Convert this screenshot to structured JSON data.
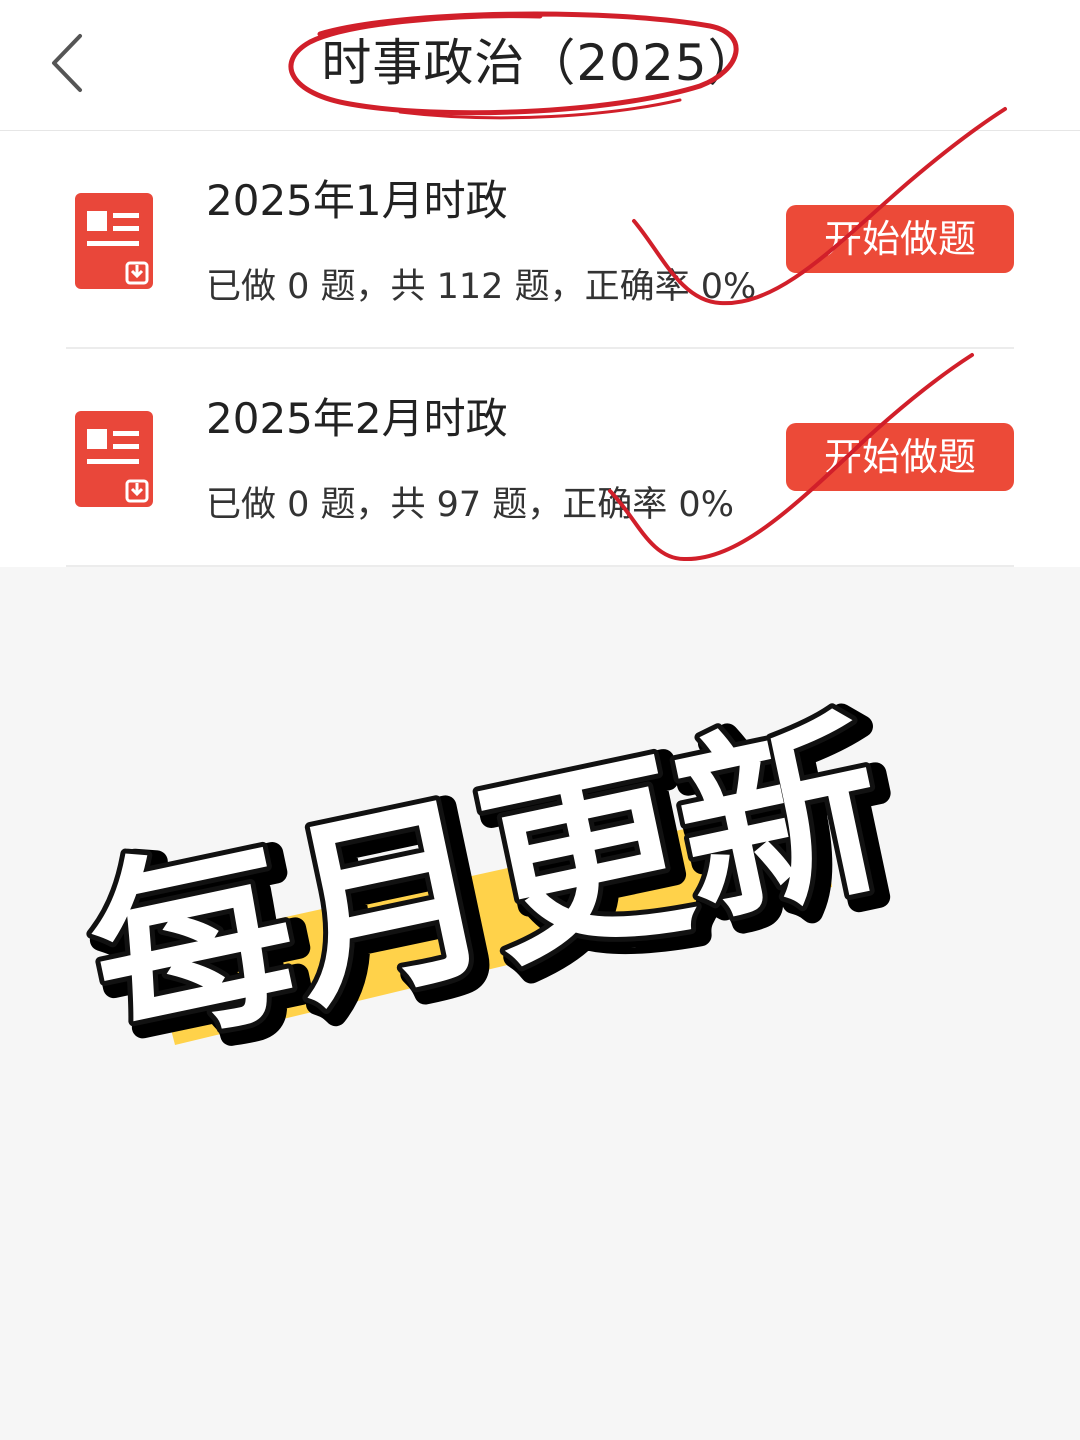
{
  "header": {
    "title": "时事政治（2025）",
    "back_icon": "chevron-left-icon"
  },
  "items": [
    {
      "title": "2025年1月时政",
      "stats": "已做 0 题，共 112 题，正确率 0%",
      "button_label": "开始做题",
      "icon": "document-icon"
    },
    {
      "title": "2025年2月时政",
      "stats": "已做 0 题，共 97 题，正确率 0%",
      "button_label": "开始做题",
      "icon": "document-icon"
    }
  ],
  "promo": {
    "text": "每月更新"
  },
  "colors": {
    "accent": "#ec4a38",
    "annotation": "#d11f2a",
    "highlight": "#ffd24a"
  }
}
